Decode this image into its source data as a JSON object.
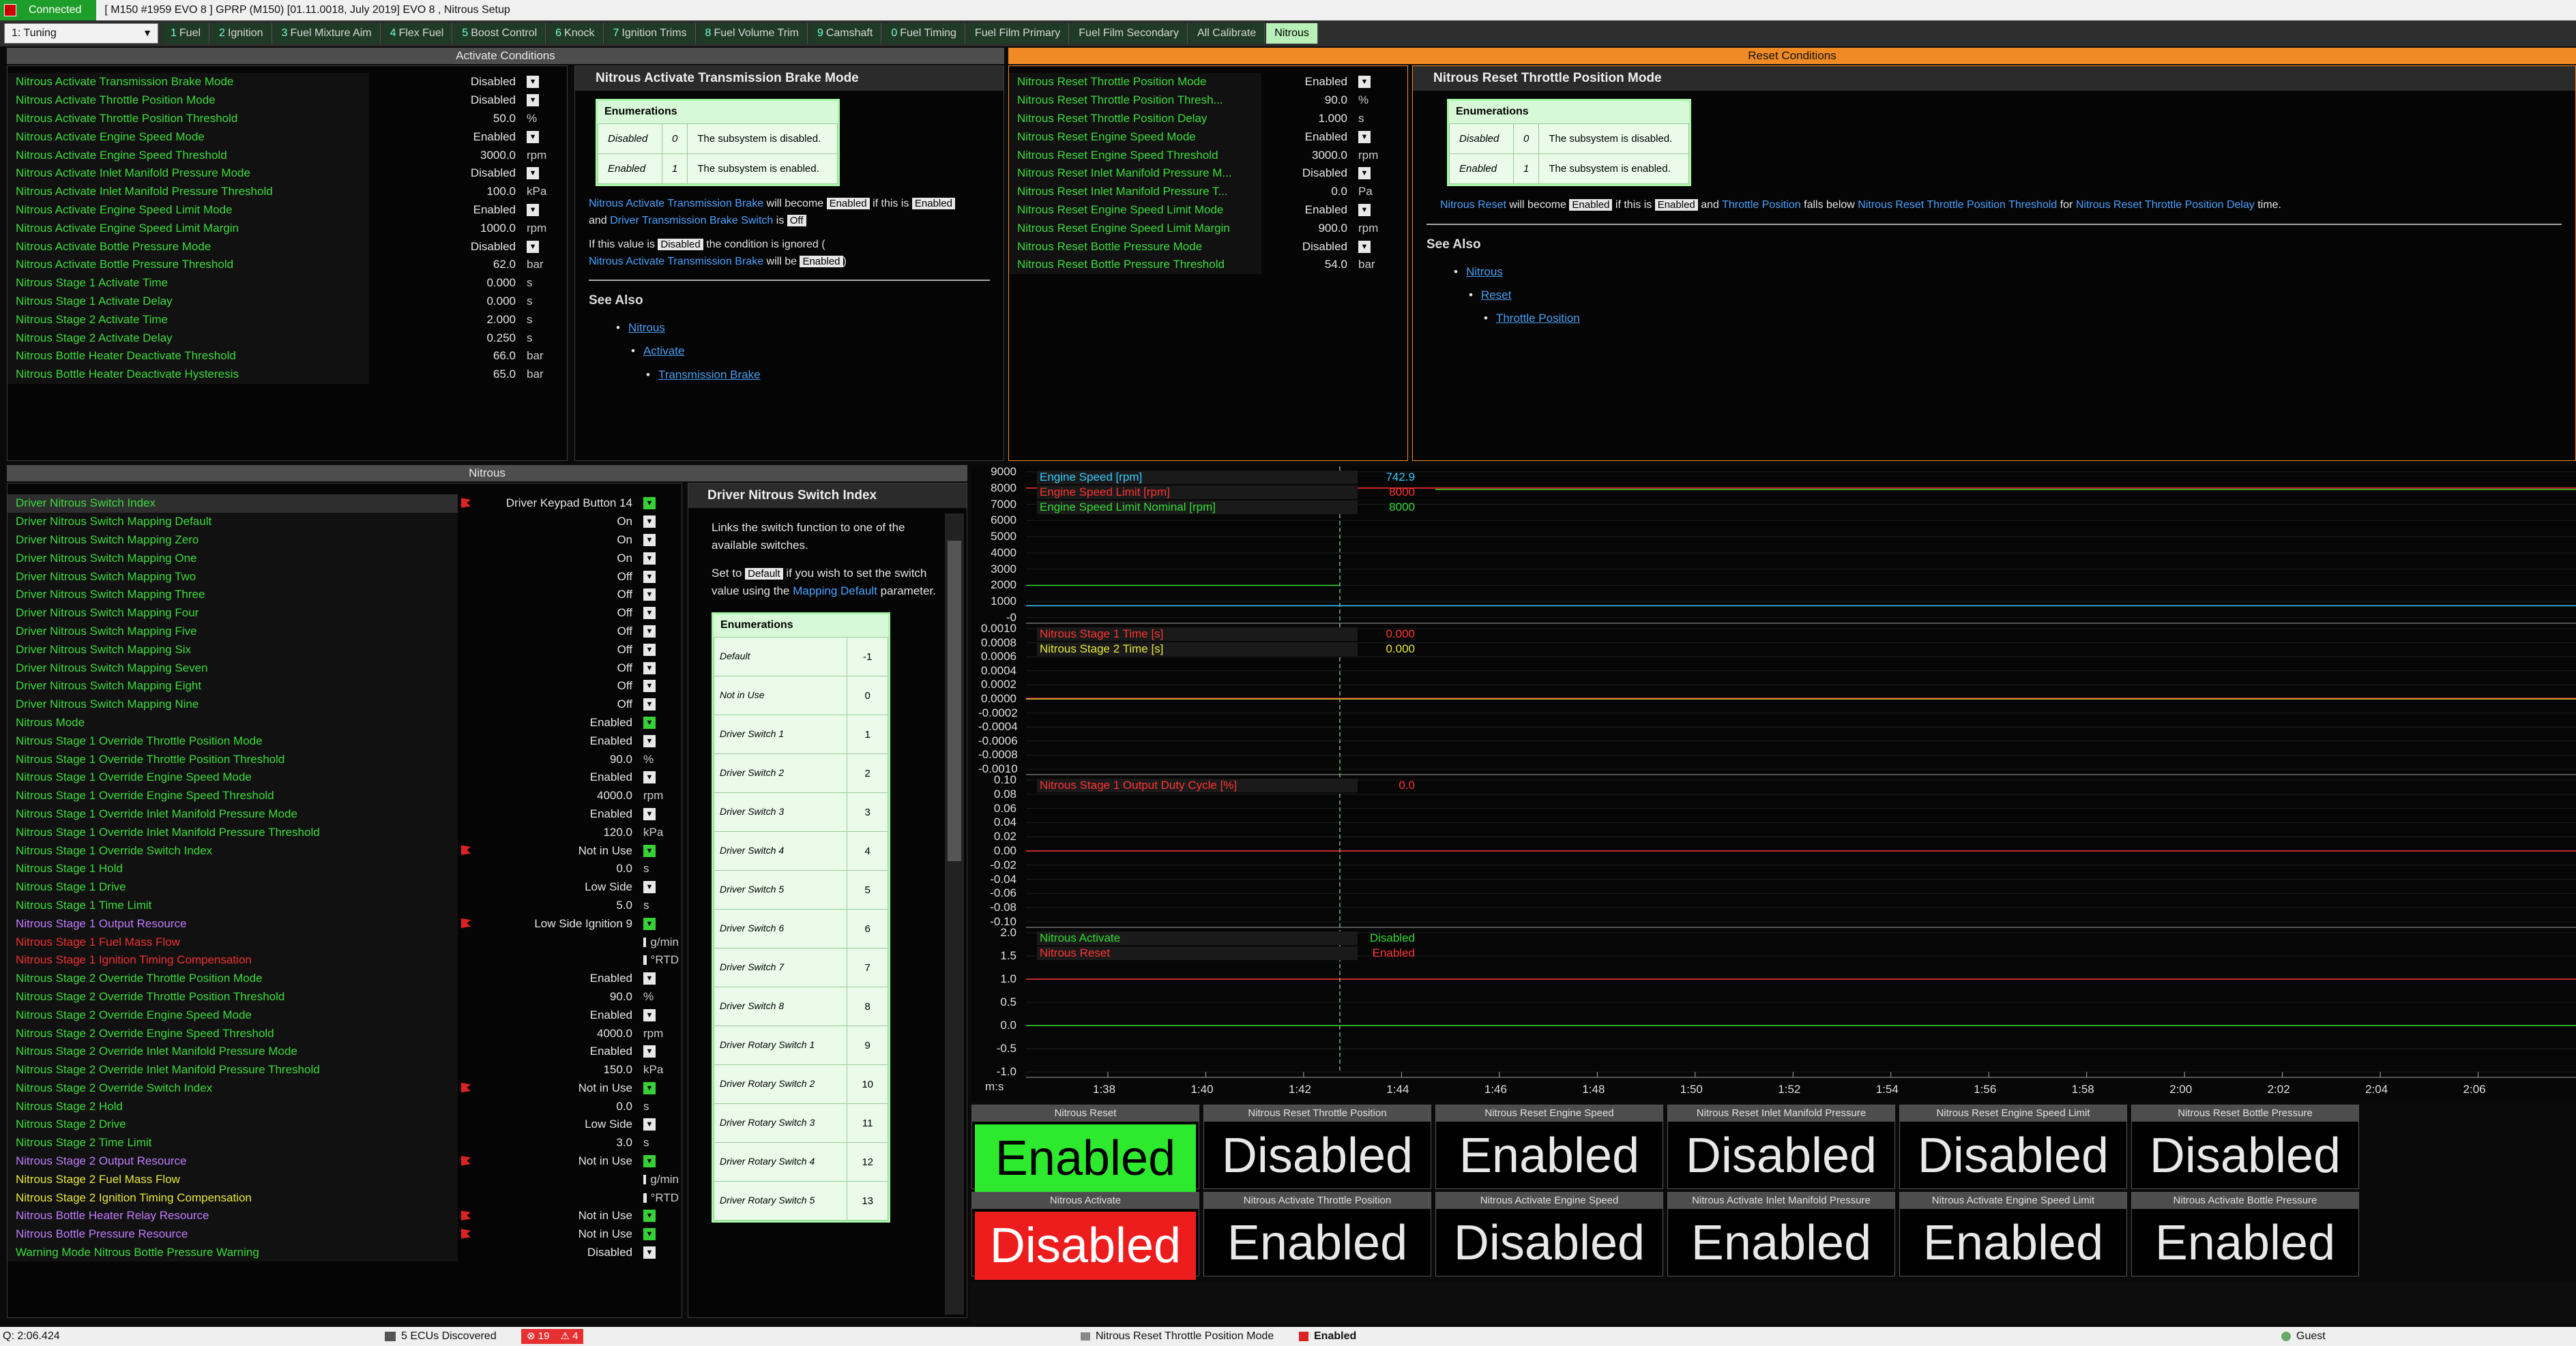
{
  "titlebar": {
    "status": "Connected",
    "text": "[ M150 #1959 EVO 8 ]  GPRP (M150) [01.11.0018, July 2019] EVO 8  ,  Nitrous Setup"
  },
  "toolbar": {
    "workspace": "1: Tuning",
    "tabs": [
      {
        "num": "1",
        "label": "Fuel"
      },
      {
        "num": "2",
        "label": "Ignition"
      },
      {
        "num": "3",
        "label": "Fuel Mixture Aim"
      },
      {
        "num": "4",
        "label": "Flex Fuel"
      },
      {
        "num": "5",
        "label": "Boost Control"
      },
      {
        "num": "6",
        "label": "Knock"
      },
      {
        "num": "7",
        "label": "Ignition Trims"
      },
      {
        "num": "8",
        "label": "Fuel Volume Trim"
      },
      {
        "num": "9",
        "label": "Camshaft"
      },
      {
        "num": "0",
        "label": "Fuel Timing"
      },
      {
        "num": "",
        "label": "Fuel Film Primary"
      },
      {
        "num": "",
        "label": "Fuel Film Secondary"
      },
      {
        "num": "",
        "label": "All Calibrate"
      },
      {
        "num": "",
        "label": "Nitrous"
      }
    ]
  },
  "activate": {
    "header": "Activate Conditions",
    "rows": [
      {
        "name": "Nitrous Activate Transmission Brake Mode",
        "value": "Disabled",
        "unit": "",
        "dd": true
      },
      {
        "name": "Nitrous Activate Throttle Position Mode",
        "value": "Disabled",
        "unit": "",
        "dd": true
      },
      {
        "name": "Nitrous Activate Throttle Position Threshold",
        "value": "50.0",
        "unit": "%"
      },
      {
        "name": "Nitrous Activate Engine Speed Mode",
        "value": "Enabled",
        "unit": "",
        "dd": true
      },
      {
        "name": "Nitrous Activate Engine Speed Threshold",
        "value": "3000.0",
        "unit": "rpm"
      },
      {
        "name": "Nitrous Activate Inlet Manifold Pressure Mode",
        "value": "Disabled",
        "unit": "",
        "dd": true
      },
      {
        "name": "Nitrous Activate Inlet Manifold Pressure Threshold",
        "value": "100.0",
        "unit": "kPa"
      },
      {
        "name": "Nitrous Activate Engine Speed Limit Mode",
        "value": "Enabled",
        "unit": "",
        "dd": true
      },
      {
        "name": "Nitrous Activate Engine Speed Limit Margin",
        "value": "1000.0",
        "unit": "rpm"
      },
      {
        "name": "Nitrous Activate Bottle Pressure Mode",
        "value": "Disabled",
        "unit": "",
        "dd": true
      },
      {
        "name": "Nitrous Activate Bottle Pressure Threshold",
        "value": "62.0",
        "unit": "bar"
      },
      {
        "name": "Nitrous Stage 1 Activate Time",
        "value": "0.000",
        "unit": "s"
      },
      {
        "name": "Nitrous Stage 1 Activate Delay",
        "value": "0.000",
        "unit": "s"
      },
      {
        "name": "Nitrous Stage 2 Activate Time",
        "value": "2.000",
        "unit": "s"
      },
      {
        "name": "Nitrous Stage 2 Activate Delay",
        "value": "0.250",
        "unit": "s"
      },
      {
        "name": "Nitrous Bottle Heater Deactivate Threshold",
        "value": "66.0",
        "unit": "bar"
      },
      {
        "name": "Nitrous Bottle Heater Deactivate Hysteresis",
        "value": "65.0",
        "unit": "bar"
      }
    ],
    "help": {
      "title": "Nitrous Activate Transmission Brake Mode",
      "enum_header": "Enumerations",
      "enums": [
        {
          "name": "Disabled",
          "val": "0",
          "desc": "The subsystem is disabled."
        },
        {
          "name": "Enabled",
          "val": "1",
          "desc": "The subsystem is enabled."
        }
      ],
      "line1_link": "Nitrous Activate Transmission Brake",
      "line1_mid": " will become ",
      "line1_box1": "Enabled",
      "line1_mid2": " if this is ",
      "line1_box2": "Enabled",
      "line2_pre": "and ",
      "line2_link": "Driver Transmission Brake Switch",
      "line2_mid": " is ",
      "line2_box": "Off",
      "line3_pre": "If this value is ",
      "line3_box": "Disabled",
      "line3_mid": " the condition is ignored (",
      "line4_link": "Nitrous Activate Transmission Brake",
      "line4_mid": " will be ",
      "line4_box": "Enabled",
      "line4_end": ")",
      "see_also": "See Also",
      "links": [
        "Nitrous",
        "Activate",
        "Transmission Brake"
      ]
    }
  },
  "reset": {
    "header": "Reset Conditions",
    "rows": [
      {
        "name": "Nitrous Reset Throttle Position Mode",
        "value": "Enabled",
        "unit": "",
        "dd": true
      },
      {
        "name": "Nitrous Reset Throttle Position Thresh...",
        "value": "90.0",
        "unit": "%"
      },
      {
        "name": "Nitrous Reset Throttle Position Delay",
        "value": "1.000",
        "unit": "s"
      },
      {
        "name": "Nitrous Reset Engine Speed Mode",
        "value": "Enabled",
        "unit": "",
        "dd": true
      },
      {
        "name": "Nitrous Reset Engine Speed Threshold",
        "value": "3000.0",
        "unit": "rpm"
      },
      {
        "name": "Nitrous Reset Inlet Manifold Pressure M...",
        "value": "Disabled",
        "unit": "",
        "dd": true
      },
      {
        "name": "Nitrous Reset Inlet Manifold Pressure T...",
        "value": "0.0",
        "unit": "Pa"
      },
      {
        "name": "Nitrous Reset Engine Speed Limit Mode",
        "value": "Enabled",
        "unit": "",
        "dd": true
      },
      {
        "name": "Nitrous Reset Engine Speed Limit Margin",
        "value": "900.0",
        "unit": "rpm"
      },
      {
        "name": "Nitrous Reset Bottle Pressure Mode",
        "value": "Disabled",
        "unit": "",
        "dd": true
      },
      {
        "name": "Nitrous Reset Bottle Pressure Threshold",
        "value": "54.0",
        "unit": "bar"
      }
    ],
    "help": {
      "title": "Nitrous Reset Throttle Position Mode",
      "enum_header": "Enumerations",
      "enums": [
        {
          "name": "Disabled",
          "val": "0",
          "desc": "The subsystem is disabled."
        },
        {
          "name": "Enabled",
          "val": "1",
          "desc": "The subsystem is enabled."
        }
      ],
      "l_link1": "Nitrous Reset",
      "l_mid1": " will become ",
      "l_box1": "Enabled",
      "l_mid2": " if this is ",
      "l_box2": "Enabled",
      "l_mid3": " and ",
      "l_link2": "Throttle Position",
      "l_mid4": " falls below ",
      "l_link3": "Nitrous Reset Throttle Position Threshold",
      "l_mid5": " for ",
      "l_link4": "Nitrous Reset Throttle Position Delay",
      "l_end": " time.",
      "see_also": "See Also",
      "links": [
        "Nitrous",
        "Reset",
        "Throttle Position"
      ]
    }
  },
  "nitrous": {
    "header": "Nitrous",
    "rows": [
      {
        "name": "Driver Nitrous Switch Index",
        "value": "Driver Keypad Button 14",
        "color": "green",
        "flag": true,
        "dd": "g",
        "sel": true
      },
      {
        "name": "Driver Nitrous Switch Mapping Default",
        "value": "On",
        "color": "green",
        "dd": "w"
      },
      {
        "name": "Driver Nitrous Switch Mapping Zero",
        "value": "On",
        "color": "green",
        "dd": "w"
      },
      {
        "name": "Driver Nitrous Switch Mapping One",
        "value": "On",
        "color": "green",
        "dd": "w"
      },
      {
        "name": "Driver Nitrous Switch Mapping Two",
        "value": "Off",
        "color": "green",
        "dd": "w"
      },
      {
        "name": "Driver Nitrous Switch Mapping Three",
        "value": "Off",
        "color": "green",
        "dd": "w"
      },
      {
        "name": "Driver Nitrous Switch Mapping Four",
        "value": "Off",
        "color": "green",
        "dd": "w"
      },
      {
        "name": "Driver Nitrous Switch Mapping Five",
        "value": "Off",
        "color": "green",
        "dd": "w"
      },
      {
        "name": "Driver Nitrous Switch Mapping Six",
        "value": "Off",
        "color": "green",
        "dd": "w"
      },
      {
        "name": "Driver Nitrous Switch Mapping Seven",
        "value": "Off",
        "color": "green",
        "dd": "w"
      },
      {
        "name": "Driver Nitrous Switch Mapping Eight",
        "value": "Off",
        "color": "green",
        "dd": "w"
      },
      {
        "name": "Driver Nitrous Switch Mapping Nine",
        "value": "Off",
        "color": "green",
        "dd": "w"
      },
      {
        "name": "Nitrous Mode",
        "value": "Enabled",
        "color": "green",
        "dd": "g"
      },
      {
        "name": "Nitrous Stage 1 Override Throttle Position Mode",
        "value": "Enabled",
        "color": "green",
        "dd": "w"
      },
      {
        "name": "Nitrous Stage 1 Override Throttle Position Threshold",
        "value": "90.0",
        "unit": "%",
        "color": "green"
      },
      {
        "name": "Nitrous Stage 1 Override Engine Speed Mode",
        "value": "Enabled",
        "color": "green",
        "dd": "w"
      },
      {
        "name": "Nitrous Stage 1 Override Engine Speed Threshold",
        "value": "4000.0",
        "unit": "rpm",
        "color": "green"
      },
      {
        "name": "Nitrous Stage 1 Override Inlet Manifold Pressure Mode",
        "value": "Enabled",
        "color": "green",
        "dd": "w"
      },
      {
        "name": "Nitrous Stage 1 Override Inlet Manifold Pressure Threshold",
        "value": "120.0",
        "unit": "kPa",
        "color": "green"
      },
      {
        "name": "Nitrous Stage 1 Override Switch Index",
        "value": "Not in Use",
        "color": "green",
        "flag": true,
        "dd": "g"
      },
      {
        "name": "Nitrous Stage 1 Hold",
        "value": "0.0",
        "unit": "s",
        "color": "green"
      },
      {
        "name": "Nitrous Stage 1 Drive",
        "value": "Low Side",
        "color": "green",
        "dd": "w"
      },
      {
        "name": "Nitrous Stage 1 Time Limit",
        "value": "5.0",
        "unit": "s",
        "color": "green"
      },
      {
        "name": "Nitrous Stage 1 Output Resource",
        "value": "Low Side Ignition 9",
        "color": "purple",
        "flag": true,
        "dd": "g"
      },
      {
        "name": "Nitrous Stage 1 Fuel Mass Flow",
        "value": "",
        "unit": "g/min",
        "color": "red",
        "tbl": true
      },
      {
        "name": "Nitrous Stage 1 Ignition Timing Compensation",
        "value": "",
        "unit": "°RTD",
        "color": "red",
        "tbl": true
      },
      {
        "name": "Nitrous Stage 2 Override Throttle Position Mode",
        "value": "Enabled",
        "color": "green",
        "dd": "w"
      },
      {
        "name": "Nitrous Stage 2 Override Throttle Position Threshold",
        "value": "90.0",
        "unit": "%",
        "color": "green"
      },
      {
        "name": "Nitrous Stage 2 Override Engine Speed Mode",
        "value": "Enabled",
        "color": "green",
        "dd": "w"
      },
      {
        "name": "Nitrous Stage 2 Override Engine Speed Threshold",
        "value": "4000.0",
        "unit": "rpm",
        "color": "green"
      },
      {
        "name": "Nitrous Stage 2 Override Inlet Manifold Pressure Mode",
        "value": "Enabled",
        "color": "green",
        "dd": "w"
      },
      {
        "name": "Nitrous Stage 2 Override Inlet Manifold Pressure Threshold",
        "value": "150.0",
        "unit": "kPa",
        "color": "green"
      },
      {
        "name": "Nitrous Stage 2 Override Switch Index",
        "value": "Not in Use",
        "color": "green",
        "flag": true,
        "dd": "g"
      },
      {
        "name": "Nitrous Stage 2 Hold",
        "value": "0.0",
        "unit": "s",
        "color": "green"
      },
      {
        "name": "Nitrous Stage 2 Drive",
        "value": "Low Side",
        "color": "green",
        "dd": "w"
      },
      {
        "name": "Nitrous Stage 2 Time Limit",
        "value": "3.0",
        "unit": "s",
        "color": "green"
      },
      {
        "name": "Nitrous Stage 2 Output Resource",
        "value": "Not in Use",
        "color": "purple",
        "flag": true,
        "dd": "g"
      },
      {
        "name": "Nitrous Stage 2 Fuel Mass Flow",
        "value": "",
        "unit": "g/min",
        "color": "yellow",
        "tbl": true
      },
      {
        "name": "Nitrous Stage 2 Ignition Timing Compensation",
        "value": "",
        "unit": "°RTD",
        "color": "yellow",
        "tbl": true
      },
      {
        "name": "Nitrous Bottle Heater Relay Resource",
        "value": "Not in Use",
        "color": "purple",
        "flag": true,
        "dd": "g"
      },
      {
        "name": "Nitrous Bottle Pressure Resource",
        "value": "Not in Use",
        "color": "purple",
        "flag": true,
        "dd": "g"
      },
      {
        "name": "Warning Mode Nitrous Bottle Pressure Warning",
        "value": "Disabled",
        "color": "green",
        "dd": "w"
      }
    ],
    "help": {
      "title": "Driver Nitrous Switch Index",
      "p1": "Links the switch function to one of the available switches.",
      "p2_pre": "Set to ",
      "p2_box": "Default",
      "p2_mid": " if you wish to set the switch value using the ",
      "p2_link": "Mapping Default",
      "p2_end": " parameter.",
      "enum_header": "Enumerations",
      "enums": [
        {
          "name": "Default",
          "val": "-1"
        },
        {
          "name": "Not in Use",
          "val": "0"
        },
        {
          "name": "Driver Switch 1",
          "val": "1"
        },
        {
          "name": "Driver Switch 2",
          "val": "2"
        },
        {
          "name": "Driver Switch 3",
          "val": "3"
        },
        {
          "name": "Driver Switch 4",
          "val": "4"
        },
        {
          "name": "Driver Switch 5",
          "val": "5"
        },
        {
          "name": "Driver Switch 6",
          "val": "6"
        },
        {
          "name": "Driver Switch 7",
          "val": "7"
        },
        {
          "name": "Driver Switch 8",
          "val": "8"
        },
        {
          "name": "Driver Rotary Switch 1",
          "val": "9"
        },
        {
          "name": "Driver Rotary Switch 2",
          "val": "10"
        },
        {
          "name": "Driver Rotary Switch 3",
          "val": "11"
        },
        {
          "name": "Driver Rotary Switch 4",
          "val": "12"
        },
        {
          "name": "Driver Rotary Switch 5",
          "val": "13"
        }
      ]
    }
  },
  "graphs": {
    "time_ticks": [
      "1:38",
      "1:40",
      "1:42",
      "1:44",
      "1:46",
      "1:48",
      "1:50",
      "1:52",
      "1:54",
      "1:56",
      "1:58",
      "2:00",
      "2:02",
      "2:04",
      "2:06"
    ],
    "time_unit": "m:s",
    "g1": {
      "ticks": [
        "9000",
        "8000",
        "7000",
        "6000",
        "5000",
        "4000",
        "3000",
        "2000",
        "1000",
        "-0"
      ],
      "legend": [
        {
          "name": "Engine Speed [rpm]",
          "value": "742.9",
          "color": "#33ccff"
        },
        {
          "name": "Engine Speed Limit [rpm]",
          "value": "8000",
          "color": "#ff3333"
        },
        {
          "name": "Engine Speed Limit Nominal [rpm]",
          "value": "8000",
          "color": "#33dd33"
        }
      ]
    },
    "g2": {
      "ticks": [
        "0.0010",
        "0.0008",
        "0.0006",
        "0.0004",
        "0.0002",
        "0.0000",
        "-0.0002",
        "-0.0004",
        "-0.0006",
        "-0.0008",
        "-0.0010"
      ],
      "legend": [
        {
          "name": "Nitrous Stage 1 Time [s]",
          "value": "0.000",
          "color": "#ff3333"
        },
        {
          "name": "Nitrous Stage 2 Time [s]",
          "value": "0.000",
          "color": "#e8e83a"
        }
      ]
    },
    "g3": {
      "ticks": [
        "0.10",
        "0.08",
        "0.06",
        "0.04",
        "0.02",
        "0.00",
        "-0.02",
        "-0.04",
        "-0.06",
        "-0.08",
        "-0.10"
      ],
      "legend": [
        {
          "name": "Nitrous Stage 1 Output Duty Cycle [%]",
          "value": "0.0",
          "color": "#ff3333"
        }
      ]
    },
    "g4": {
      "ticks": [
        "2.0",
        "1.5",
        "1.0",
        "0.5",
        "0.0",
        "-0.5",
        "-1.0"
      ],
      "legend": [
        {
          "name": "Nitrous Activate",
          "value": "Disabled",
          "color": "#33dd33"
        },
        {
          "name": "Nitrous Reset",
          "value": "Enabled",
          "color": "#ff3333"
        }
      ]
    }
  },
  "tiles": [
    {
      "title": "Nitrous Reset",
      "value": "Enabled",
      "style": "green"
    },
    {
      "title": "Nitrous Reset Throttle Position",
      "value": "Disabled",
      "style": "plain"
    },
    {
      "title": "Nitrous Reset Engine Speed",
      "value": "Enabled",
      "style": "plain"
    },
    {
      "title": "Nitrous Reset Inlet Manifold Pressure",
      "value": "Disabled",
      "style": "plain"
    },
    {
      "title": "Nitrous Reset Engine Speed Limit",
      "value": "Disabled",
      "style": "plain"
    },
    {
      "title": "Nitrous Reset Bottle Pressure",
      "value": "Disabled",
      "style": "plain"
    },
    {
      "title": "Nitrous Activate",
      "value": "Disabled",
      "style": "red"
    },
    {
      "title": "Nitrous Activate Throttle Position",
      "value": "Enabled",
      "style": "plain"
    },
    {
      "title": "Nitrous Activate Engine Speed",
      "value": "Disabled",
      "style": "plain"
    },
    {
      "title": "Nitrous Activate Inlet Manifold Pressure",
      "value": "Enabled",
      "style": "plain"
    },
    {
      "title": "Nitrous Activate Engine Speed Limit",
      "value": "Enabled",
      "style": "plain"
    },
    {
      "title": "Nitrous Activate Bottle Pressure",
      "value": "Enabled",
      "style": "plain"
    }
  ],
  "statusbar": {
    "time": "Q: 2:06.424",
    "ecus": "5 ECUs Discovered",
    "errors": "19",
    "warnings": "4",
    "param": "Nitrous Reset Throttle Position Mode",
    "param_value": "Enabled",
    "user": "Guest"
  }
}
